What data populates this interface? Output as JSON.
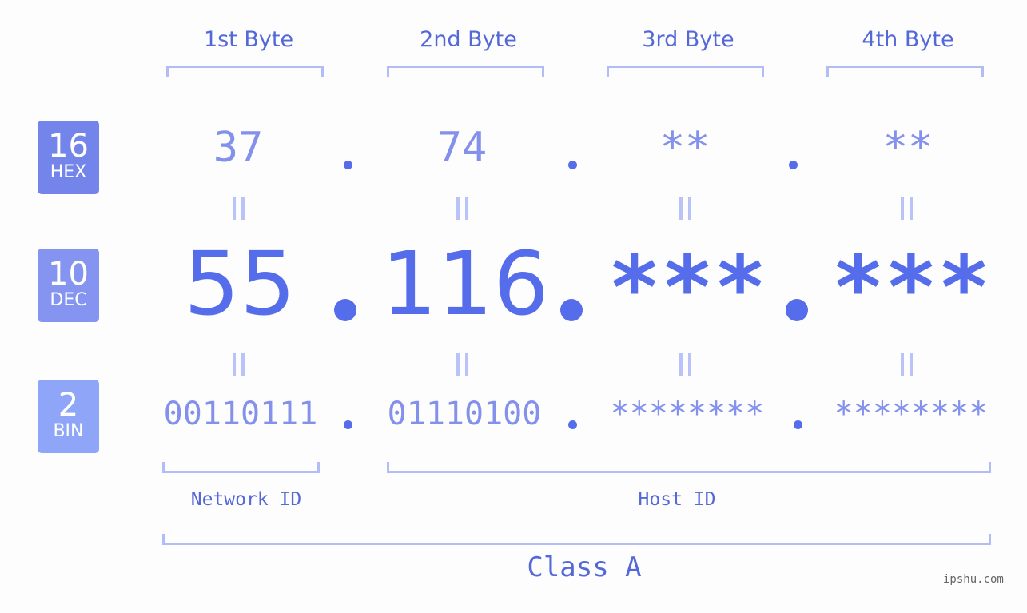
{
  "bases": [
    {
      "number": "16",
      "label": "HEX",
      "color": "#7384eb"
    },
    {
      "number": "10",
      "label": "DEC",
      "color": "#8494f0"
    },
    {
      "number": "2",
      "label": "BIN",
      "color": "#8fa6f8"
    }
  ],
  "byte_headers": [
    "1st Byte",
    "2nd Byte",
    "3rd Byte",
    "4th Byte"
  ],
  "hex": [
    "37",
    "74",
    "**",
    "**"
  ],
  "dec": [
    "55",
    "116",
    "***",
    "***"
  ],
  "bin": [
    "00110111",
    "01110100",
    "********",
    "********"
  ],
  "network_label": "Network ID",
  "host_label": "Host ID",
  "class_label": "Class A",
  "watermark": "ipshu.com",
  "colors": {
    "primary": "#566deb",
    "light": "#8390ec",
    "bracket": "#b2bcf6"
  }
}
